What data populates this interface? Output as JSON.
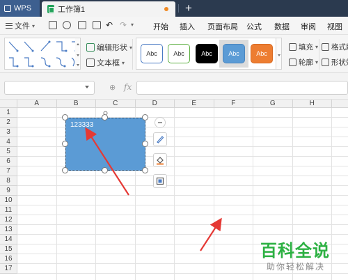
{
  "window": {
    "app_tab": "WPS",
    "doc_tab": "工作簿1"
  },
  "menu": {
    "file": "文件",
    "items": [
      "开始",
      "插入",
      "页面布局",
      "公式",
      "数据",
      "审阅",
      "视图"
    ]
  },
  "ribbon": {
    "edit_shape": "编辑形状",
    "text_box": "文本框",
    "style_label": "Abc",
    "styles": [
      {
        "bg": "#ffffff",
        "border": "#4a7bc4",
        "color": "#333333"
      },
      {
        "bg": "#ffffff",
        "border": "#5eb043",
        "color": "#333333"
      },
      {
        "bg": "#000000",
        "border": "#000000",
        "color": "#ffffff"
      },
      {
        "bg": "#5b9bd5",
        "border": "#4a86bf",
        "color": "#ffffff"
      },
      {
        "bg": "#ed7d31",
        "border": "#d86a22",
        "color": "#ffffff"
      }
    ],
    "fill": "填充",
    "outline": "轮廓",
    "format_brush": "格式刷",
    "shape_effect": "形状效"
  },
  "formula_bar": {
    "fx": "fx"
  },
  "sheet": {
    "columns": [
      "A",
      "B",
      "C",
      "D",
      "E",
      "F",
      "G",
      "H",
      "I"
    ],
    "rows": [
      "1",
      "2",
      "3",
      "4",
      "5",
      "6",
      "7",
      "8",
      "9",
      "10",
      "11",
      "12",
      "13",
      "14",
      "15",
      "16",
      "17"
    ]
  },
  "shape": {
    "text": "123333",
    "fill_color": "#5b9bd5"
  },
  "watermark": {
    "title": "百科全说",
    "subtitle": "助你轻松解决"
  }
}
